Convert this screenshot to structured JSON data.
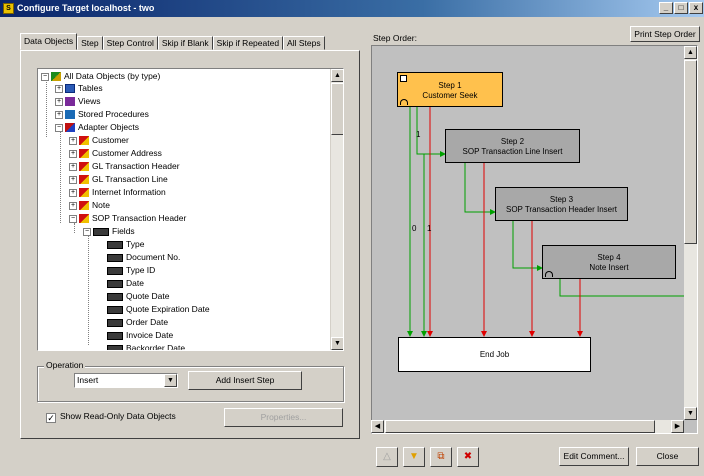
{
  "window": {
    "title": "Configure Target localhost - two",
    "minimize_label": "_",
    "restore_label": "□",
    "close_label": "x"
  },
  "tabs": [
    {
      "label": "Data Objects",
      "active": true
    },
    {
      "label": "Step",
      "active": false
    },
    {
      "label": "Step Control",
      "active": false
    },
    {
      "label": "Skip if Blank",
      "active": false
    },
    {
      "label": "Skip if Repeated",
      "active": false
    },
    {
      "label": "All Steps",
      "active": false
    }
  ],
  "tree": {
    "items": [
      {
        "label": "All Data Objects (by type)",
        "icon": "database-icon",
        "expander": "−"
      },
      {
        "label": "Tables",
        "icon": "table-icon",
        "expander": "+"
      },
      {
        "label": "Views",
        "icon": "view-icon",
        "expander": "+"
      },
      {
        "label": "Stored Procedures",
        "icon": "procedure-icon",
        "expander": "+"
      },
      {
        "label": "Adapter Objects",
        "icon": "adapter-icon",
        "expander": "−"
      },
      {
        "label": "Customer",
        "icon": "object-icon",
        "expander": "+"
      },
      {
        "label": "Customer Address",
        "icon": "object-icon",
        "expander": "+"
      },
      {
        "label": "GL Transaction Header",
        "icon": "object-icon",
        "expander": "+"
      },
      {
        "label": "GL Transaction Line",
        "icon": "object-icon",
        "expander": "+"
      },
      {
        "label": "Internet Information",
        "icon": "object-icon",
        "expander": "+"
      },
      {
        "label": "Note",
        "icon": "object-icon",
        "expander": "+"
      },
      {
        "label": "SOP Transaction Header",
        "icon": "object-icon",
        "expander": "−"
      },
      {
        "label": "Fields",
        "icon": "fields-icon",
        "expander": "−"
      },
      {
        "label": "Type",
        "icon": "field-icon"
      },
      {
        "label": "Document No.",
        "icon": "field-icon"
      },
      {
        "label": "Type ID",
        "icon": "field-icon"
      },
      {
        "label": "Date",
        "icon": "field-icon"
      },
      {
        "label": "Quote Date",
        "icon": "field-icon"
      },
      {
        "label": "Quote Expiration Date",
        "icon": "field-icon"
      },
      {
        "label": "Order Date",
        "icon": "field-icon"
      },
      {
        "label": "Invoice Date",
        "icon": "field-icon"
      },
      {
        "label": "Backorder Date",
        "icon": "field-icon"
      }
    ]
  },
  "operation": {
    "group_label": "Operation",
    "selected": "Insert",
    "add_button": "Add Insert Step"
  },
  "show_readonly": {
    "label": "Show Read-Only Data Objects",
    "checked": true,
    "check_glyph": "✓"
  },
  "properties_button": "Properties...",
  "step_order_label": "Step Order:",
  "print_button": "Print Step Order",
  "steps": [
    {
      "line1": "Step 1",
      "line2": "Customer Seek"
    },
    {
      "line1": "Step 2",
      "line2": "SOP Transaction Line Insert"
    },
    {
      "line1": "Step 3",
      "line2": "SOP Transaction Header Insert"
    },
    {
      "line1": "Step 4",
      "line2": "Note Insert"
    },
    {
      "line1": "End Job",
      "line2": ""
    }
  ],
  "edge_labels": [
    "1",
    "0",
    "1"
  ],
  "colors": {
    "success_line": "#00a000",
    "failure_line": "#e00000",
    "active_step": "#ffc14d",
    "step": "#a8a8a8"
  },
  "bottom": {
    "edit_comment": "Edit Comment...",
    "close": "Close"
  }
}
